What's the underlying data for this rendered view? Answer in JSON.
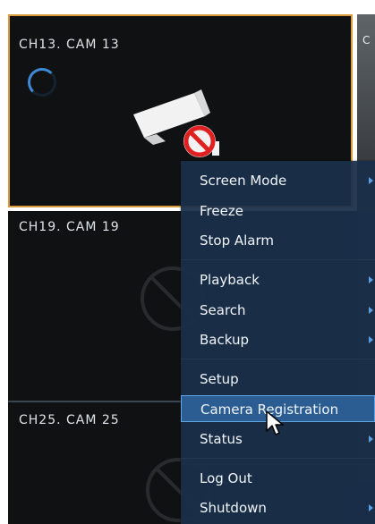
{
  "tiles": [
    {
      "label": "CH13. CAM 13",
      "state": "loading"
    },
    {
      "label": "CH19. CAM 19",
      "state": "no-video"
    },
    {
      "label": "CH25. CAM 25",
      "state": "no-video"
    }
  ],
  "right_tile_tag": "C",
  "context_menu": {
    "items": [
      {
        "label": "Screen Mode",
        "submenu": true
      },
      {
        "label": "Freeze",
        "submenu": false
      },
      {
        "label": "Stop Alarm",
        "submenu": false
      },
      {
        "label": "Playback",
        "submenu": true
      },
      {
        "label": "Search",
        "submenu": true
      },
      {
        "label": "Backup",
        "submenu": true
      },
      {
        "label": "Setup",
        "submenu": false
      },
      {
        "label": "Camera Registration",
        "submenu": false,
        "highlighted": true
      },
      {
        "label": "Status",
        "submenu": true
      },
      {
        "label": "Log Out",
        "submenu": false
      },
      {
        "label": "Shutdown",
        "submenu": true
      }
    ]
  },
  "colors": {
    "tile_bg": "#0f1113",
    "selected_border": "#d99b3c",
    "menu_bg": "#1b2f4a",
    "menu_highlight": "#2b5d92",
    "accent_blue": "#3f8ad6",
    "no_entry_red": "#e02020"
  }
}
